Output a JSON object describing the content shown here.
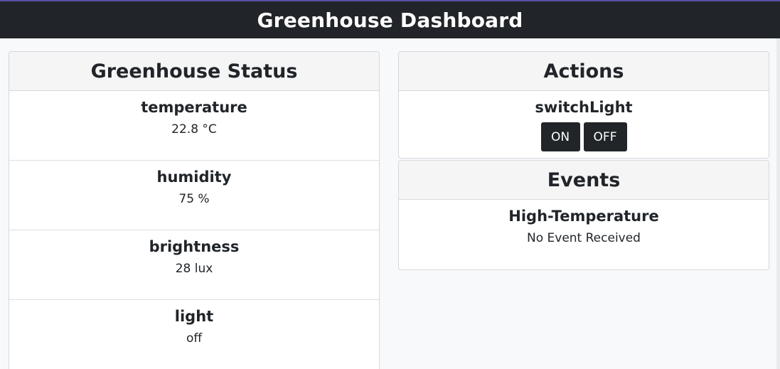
{
  "header": {
    "title": "Greenhouse Dashboard"
  },
  "status": {
    "title": "Greenhouse Status",
    "items": [
      {
        "label": "temperature",
        "value": "22.8 °C"
      },
      {
        "label": "humidity",
        "value": "75 %"
      },
      {
        "label": "brightness",
        "value": "28 lux"
      },
      {
        "label": "light",
        "value": "off"
      }
    ]
  },
  "actions": {
    "title": "Actions",
    "items": [
      {
        "label": "switchLight",
        "buttons": [
          "ON",
          "OFF"
        ]
      }
    ]
  },
  "events": {
    "title": "Events",
    "items": [
      {
        "label": "High-Temperature",
        "value": "No Event Received"
      }
    ]
  },
  "colors": {
    "navbar": "#212529",
    "page_background": "#f8f9fa",
    "card_header": "#f5f5f5",
    "button": "#212529"
  }
}
